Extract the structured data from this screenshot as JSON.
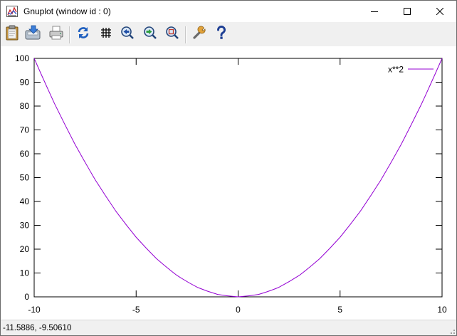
{
  "window": {
    "title": "Gnuplot (window id : 0)"
  },
  "titlebar_buttons": [
    "minimize-icon",
    "maximize-icon",
    "close-icon"
  ],
  "toolbar": {
    "icons": [
      "clipboard-icon",
      "export-icon",
      "print-icon",
      "replot-icon",
      "grid-icon",
      "zoom-previous-icon",
      "zoom-next-icon",
      "unzoom-icon",
      "options-wrench-icon",
      "help-icon"
    ]
  },
  "status": {
    "coords": "-11.5886, -9.50610"
  },
  "colors": {
    "curve": "#9400d3",
    "toolbar_bg": "#f0f0f0"
  },
  "chart_data": {
    "type": "line",
    "series": [
      {
        "name": "x**2",
        "x": [
          -10,
          -9,
          -8,
          -7,
          -6,
          -5,
          -4,
          -3,
          -2,
          -1,
          0,
          1,
          2,
          3,
          4,
          5,
          6,
          7,
          8,
          9,
          10
        ],
        "y": [
          100,
          81,
          64,
          49,
          36,
          25,
          16,
          9,
          4,
          1,
          0,
          1,
          4,
          9,
          16,
          25,
          36,
          49,
          64,
          81,
          100
        ]
      }
    ],
    "xlim": [
      -10,
      10
    ],
    "ylim": [
      0,
      100
    ],
    "xticks": [
      "-10",
      "-5",
      "0",
      "5",
      "10"
    ],
    "yticks": [
      "0",
      "10",
      "20",
      "30",
      "40",
      "50",
      "60",
      "70",
      "80",
      "90",
      "100"
    ],
    "legend": "top-right",
    "grid": false
  }
}
